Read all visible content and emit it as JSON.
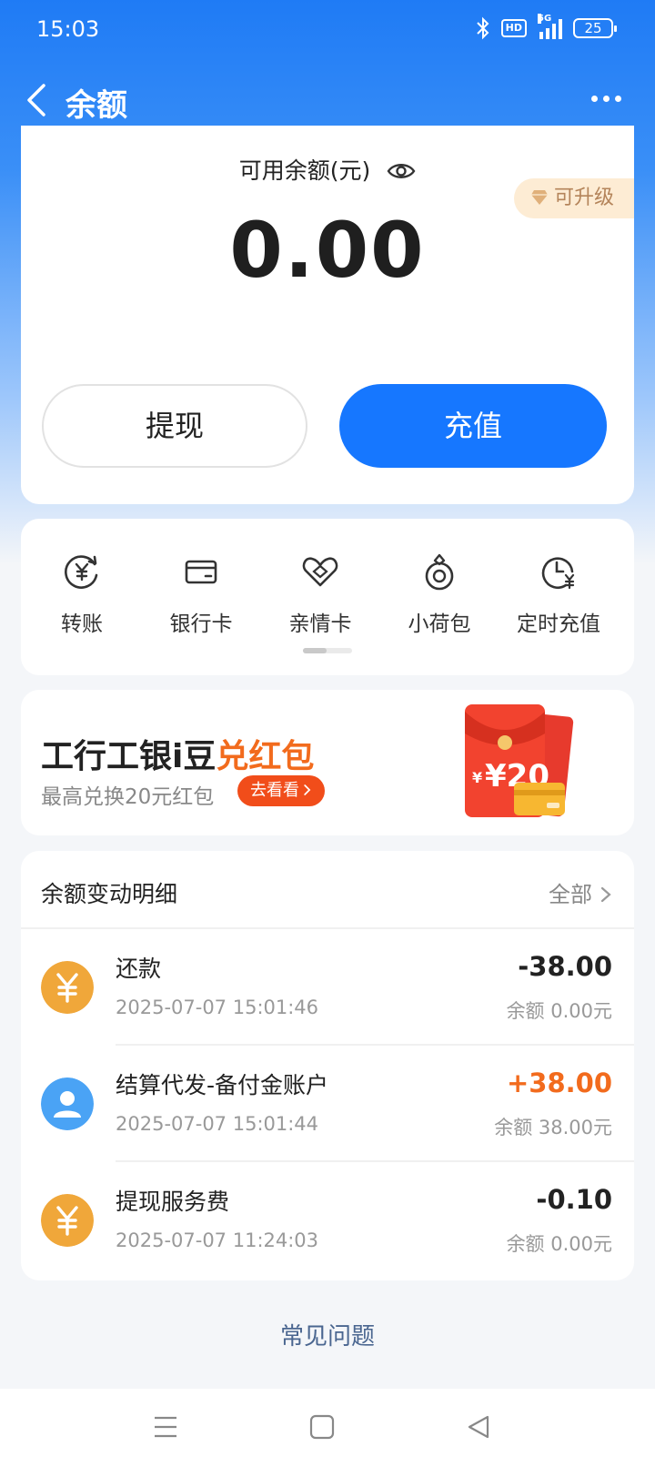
{
  "status": {
    "time": "15:03",
    "hd": "HD",
    "network": "5G",
    "battery": "25"
  },
  "nav": {
    "title": "余额"
  },
  "balance": {
    "label": "可用余额(元)",
    "amount": "0.00",
    "upgrade": "可升级",
    "withdraw_label": "提现",
    "recharge_label": "充值"
  },
  "quick_actions": [
    {
      "label": "转账",
      "icon": "transfer-icon"
    },
    {
      "label": "银行卡",
      "icon": "bank-card-icon"
    },
    {
      "label": "亲情卡",
      "icon": "family-card-icon"
    },
    {
      "label": "小荷包",
      "icon": "pouch-icon"
    },
    {
      "label": "定时充值",
      "icon": "scheduled-recharge-icon"
    }
  ],
  "promo": {
    "title_main": "工行工银i豆",
    "title_highlight": "兑红包",
    "subtitle": "最高兑换20元红包",
    "button": "去看看",
    "envelope_text": "¥20"
  },
  "detail": {
    "title": "余额变动明细",
    "all_label": "全部",
    "rows": [
      {
        "name": "还款",
        "time": "2025-07-07 15:01:46",
        "amount": "-38.00",
        "balance": "余额 0.00元",
        "icon": "yuan-icon",
        "positive": false
      },
      {
        "name": "结算代发-备付金账户",
        "time": "2025-07-07 15:01:44",
        "amount": "+38.00",
        "balance": "余额 38.00元",
        "icon": "user-icon",
        "positive": true
      },
      {
        "name": "提现服务费",
        "time": "2025-07-07 11:24:03",
        "amount": "-0.10",
        "balance": "余额 0.00元",
        "icon": "yuan-icon",
        "positive": false
      }
    ]
  },
  "faq": "常见问题",
  "colors": {
    "primary": "#1677ff",
    "accent": "#f26b1d",
    "yuan_icon": "#f0a73a",
    "user_icon": "#4aa3f5"
  }
}
